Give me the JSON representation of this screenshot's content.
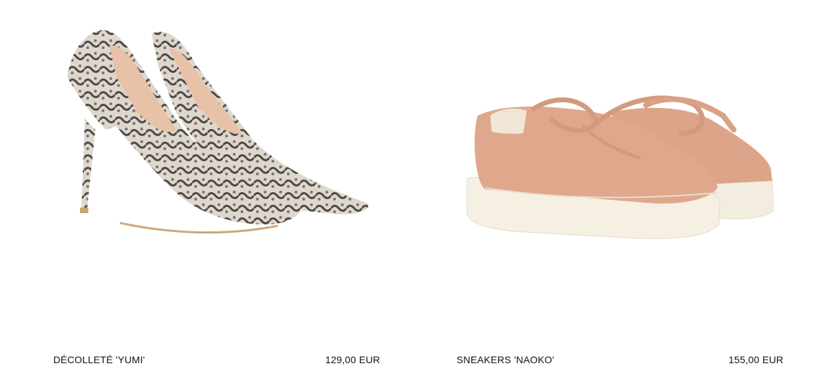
{
  "products": [
    {
      "name": "DÉCOLLETÉ 'YUMI'",
      "price": "129,00 EUR",
      "image_icon": "snakeskin-pump-shoes-image"
    },
    {
      "name": "SNEAKERS 'NAOKO'",
      "price": "155,00 EUR",
      "image_icon": "pink-platform-sneakers-image"
    }
  ],
  "colors": {
    "snake_light": "#d9d3c8",
    "snake_dark": "#5a5352",
    "lining": "#e8c2a8",
    "sneaker_pink": "#dfa88d",
    "sole_cream": "#f5efe2"
  }
}
